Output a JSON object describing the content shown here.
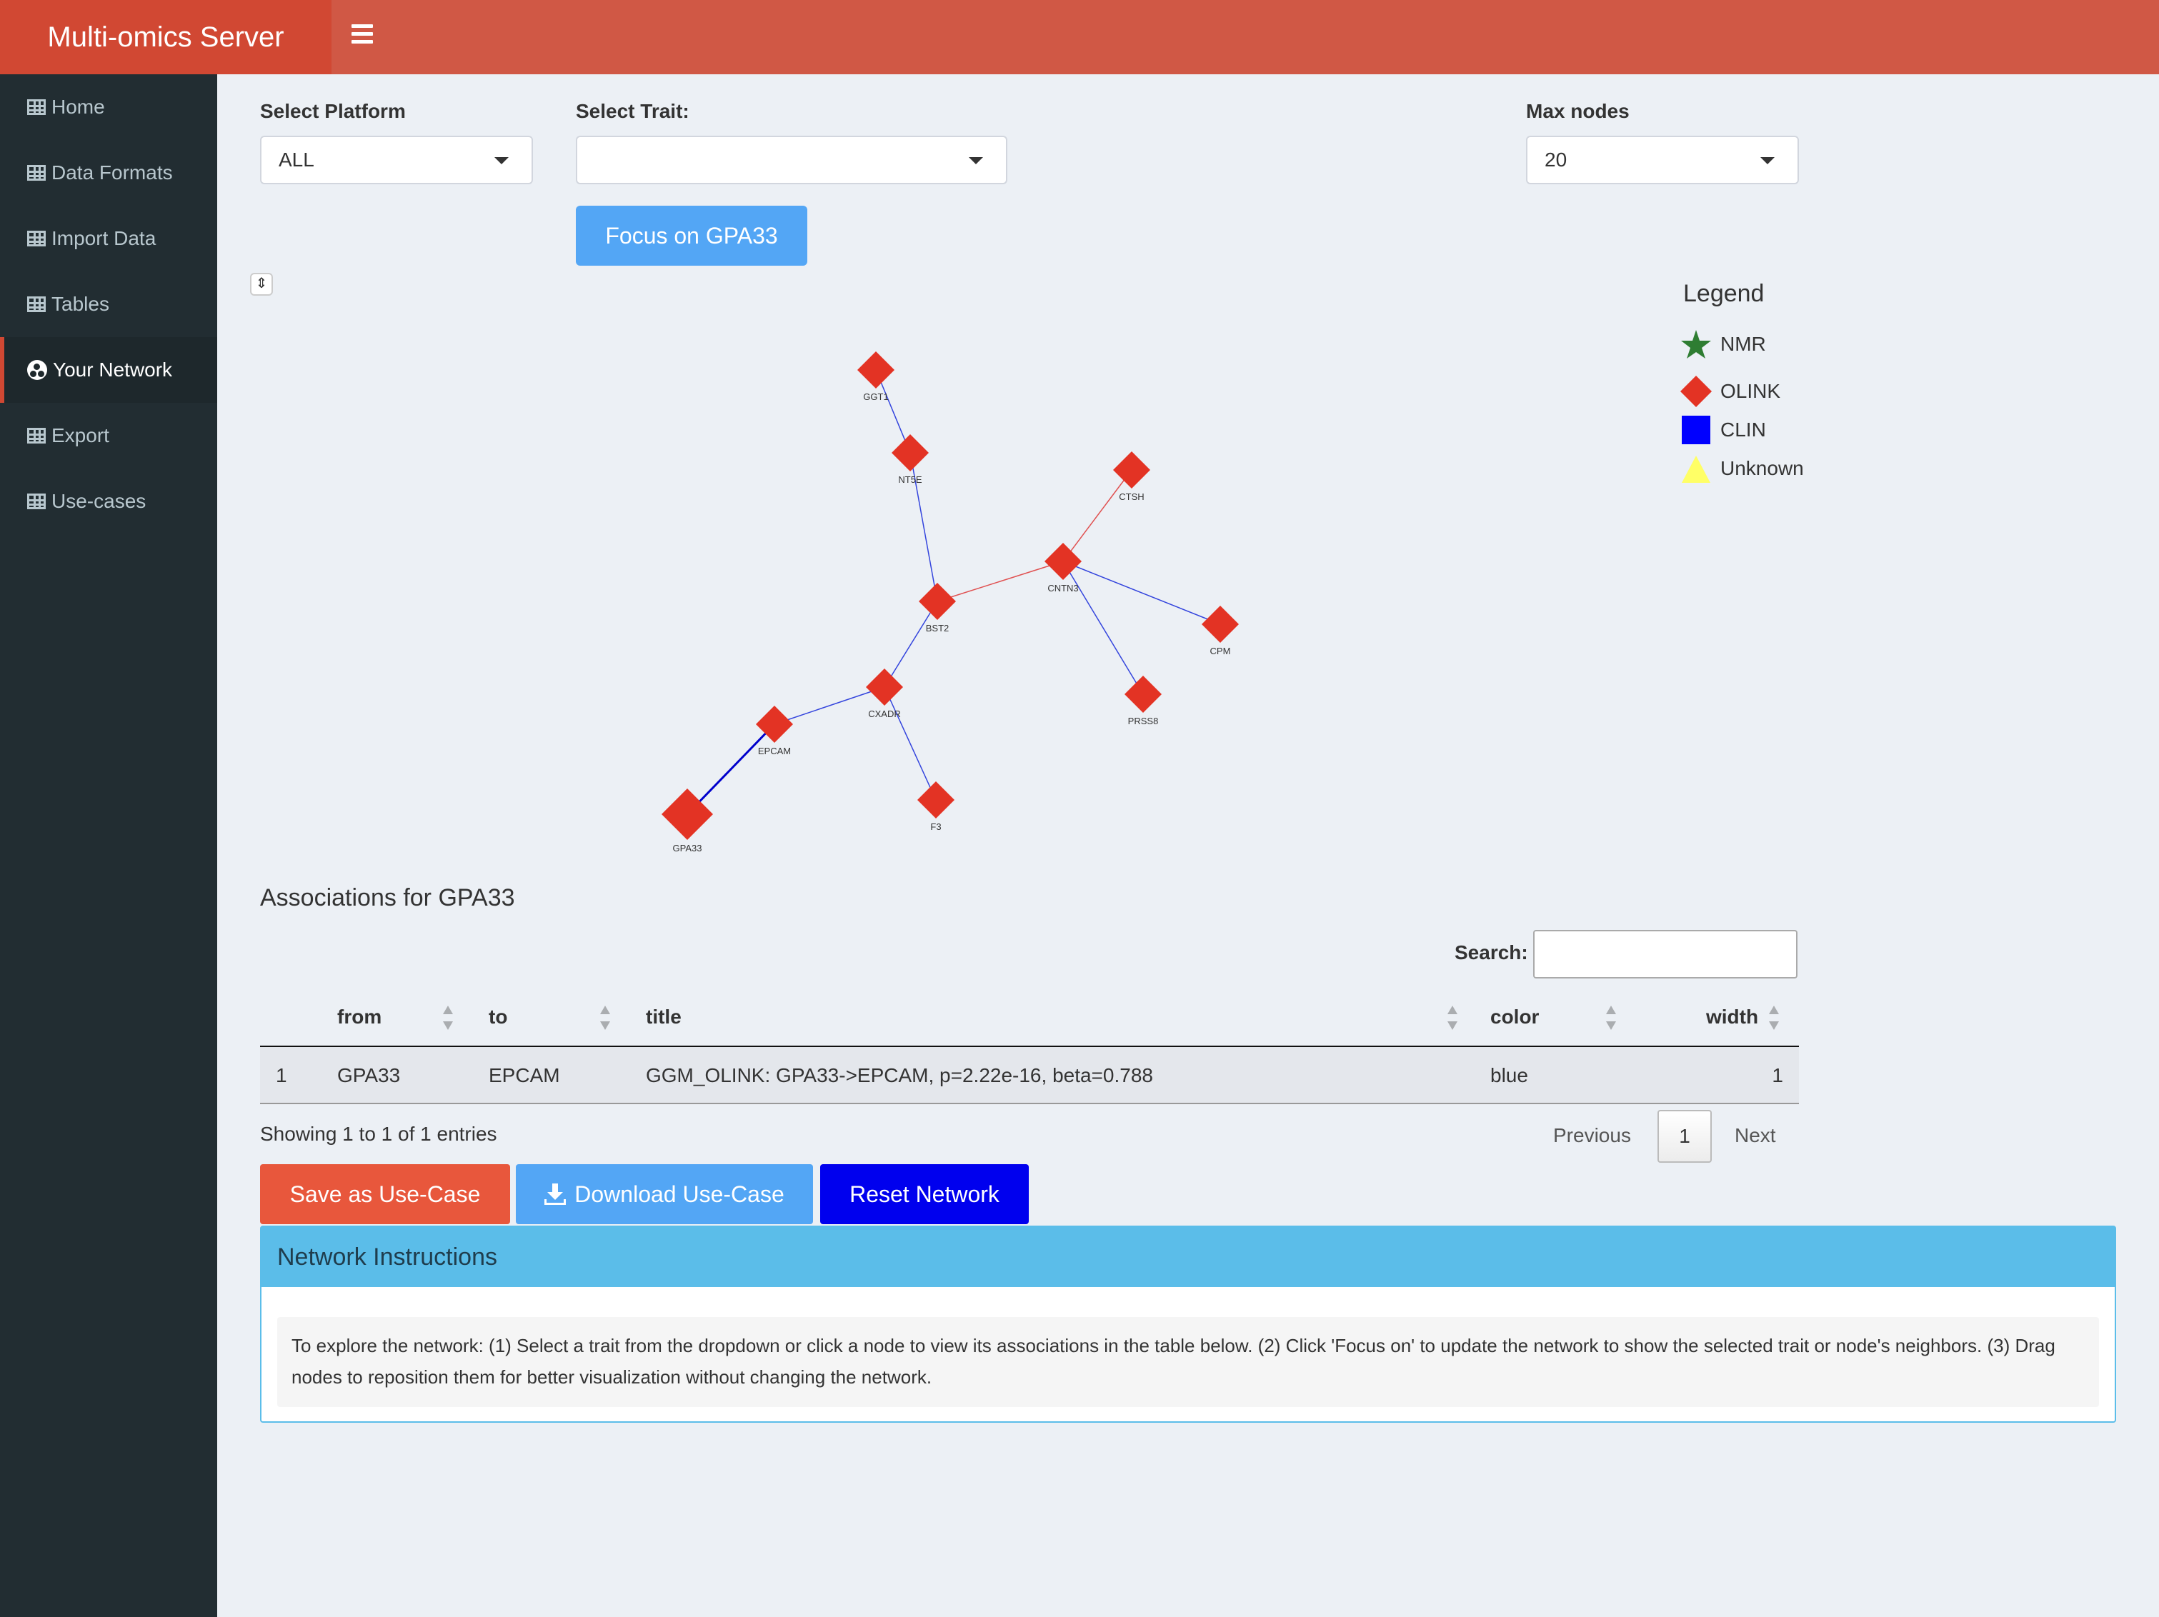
{
  "app": {
    "title": "Multi-omics Server"
  },
  "sidebar": {
    "items": [
      {
        "label": "Home"
      },
      {
        "label": "Data Formats"
      },
      {
        "label": "Import Data"
      },
      {
        "label": "Tables"
      },
      {
        "label": "Your Network",
        "active": true
      },
      {
        "label": "Export"
      },
      {
        "label": "Use-cases"
      }
    ]
  },
  "controls": {
    "platform_label": "Select Platform",
    "platform_value": "ALL",
    "trait_label": "Select Trait:",
    "trait_value": "",
    "maxnodes_label": "Max nodes",
    "maxnodes_value": "20",
    "focus_button": "Focus on GPA33"
  },
  "legend": {
    "title": "Legend",
    "items": [
      {
        "label": "NMR",
        "shape": "star",
        "color": "#2e7d32"
      },
      {
        "label": "OLINK",
        "shape": "diamond",
        "color": "#e33324"
      },
      {
        "label": "CLIN",
        "shape": "square",
        "color": "#0000ff"
      },
      {
        "label": "Unknown",
        "shape": "triangle",
        "color": "#ffff66"
      }
    ]
  },
  "network": {
    "nodes": [
      "GGT1",
      "NT5E",
      "CTSH",
      "CNTN3",
      "BST2",
      "CPM",
      "CXADR",
      "PRSS8",
      "EPCAM",
      "F3",
      "GPA33"
    ],
    "edges": [
      {
        "from": "GGT1",
        "to": "NT5E",
        "color": "blue"
      },
      {
        "from": "NT5E",
        "to": "BST2",
        "color": "blue"
      },
      {
        "from": "CTSH",
        "to": "CNTN3",
        "color": "red"
      },
      {
        "from": "CNTN3",
        "to": "BST2",
        "color": "red"
      },
      {
        "from": "CNTN3",
        "to": "CPM",
        "color": "blue"
      },
      {
        "from": "CNTN3",
        "to": "PRSS8",
        "color": "blue"
      },
      {
        "from": "BST2",
        "to": "CXADR",
        "color": "blue"
      },
      {
        "from": "CXADR",
        "to": "EPCAM",
        "color": "blue"
      },
      {
        "from": "CXADR",
        "to": "F3",
        "color": "blue"
      },
      {
        "from": "EPCAM",
        "to": "GPA33",
        "color": "blue"
      }
    ],
    "node_color": "#e33324",
    "focus_node": "GPA33"
  },
  "associations": {
    "title": "Associations for GPA33",
    "search_label": "Search:",
    "columns": [
      "from",
      "to",
      "title",
      "color",
      "width"
    ],
    "rows": [
      {
        "index": "1",
        "from": "GPA33",
        "to": "EPCAM",
        "title": "GGM_OLINK: GPA33->EPCAM, p=2.22e-16, beta=0.788",
        "color": "blue",
        "width": "1"
      }
    ],
    "showing": "Showing 1 to 1 of 1 entries",
    "pagination": {
      "previous": "Previous",
      "current": "1",
      "next": "Next"
    }
  },
  "actions": {
    "save": "Save as Use-Case",
    "download": "Download Use-Case",
    "reset": "Reset Network"
  },
  "instructions": {
    "title": "Network Instructions",
    "text": "To explore the network: (1) Select a trait from the dropdown or click a node to view its associations in the table below. (2) Click 'Focus on' to update the network to show the selected trait or node's neighbors. (3) Drag nodes to reposition them for better visualization without changing the network."
  }
}
